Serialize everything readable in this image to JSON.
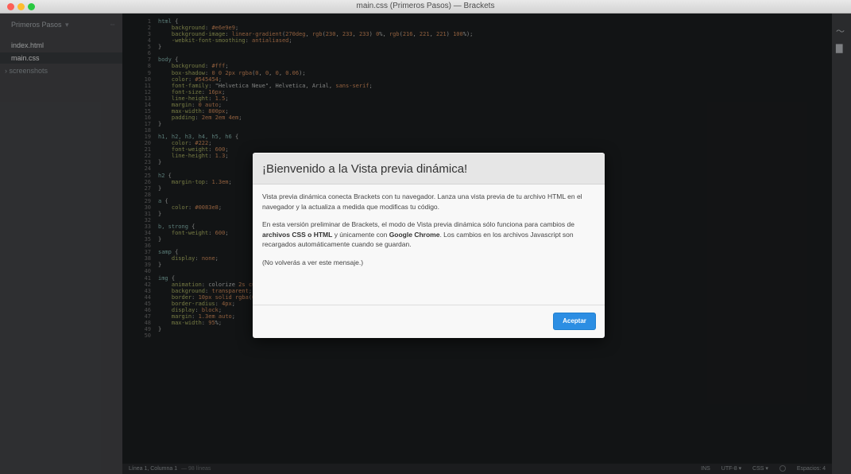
{
  "window": {
    "title": "main.css (Primeros Pasos) — Brackets"
  },
  "sidebar": {
    "project_name": "Primeros Pasos",
    "project_caret": "▾",
    "split_icon": "⇔",
    "files": [
      {
        "label": "index.html"
      },
      {
        "label": "main.css"
      },
      {
        "label": "› screenshots"
      }
    ]
  },
  "editor": {
    "lines": [
      "html {",
      "    background: #e6e9e9;",
      "    background-image: linear-gradient(270deg, rgb(230, 233, 233) 0%, rgb(216, 221, 221) 100%);",
      "    -webkit-font-smoothing: antialiased;",
      "}",
      "",
      "body {",
      "    background: #fff;",
      "    box-shadow: 0 0 2px rgba(0, 0, 0, 0.06);",
      "    color: #545454;",
      "    font-family: \"Helvetica Neue\", Helvetica, Arial, sans-serif;",
      "    font-size: 16px;",
      "    line-height: 1.5;",
      "    margin: 0 auto;",
      "    max-width: 800px;",
      "    padding: 2em 2em 4em;",
      "}",
      "",
      "h1, h2, h3, h4, h5, h6 {",
      "    color: #222;",
      "    font-weight: 600;",
      "    line-height: 1.3;",
      "}",
      "",
      "h2 {",
      "    margin-top: 1.3em;",
      "}",
      "",
      "a {",
      "    color: #0083e8;",
      "}",
      "",
      "b, strong {",
      "    font-weight: 600;",
      "}",
      "",
      "samp {",
      "    display: none;",
      "}",
      "",
      "img {",
      "    animation: colorize 2s cubic-bezier(0, 0, .78, .36) 1;",
      "    background: transparent;",
      "    border: 10px solid rgba(0, 0, 0, 0.12);",
      "    border-radius: 4px;",
      "    display: block;",
      "    margin: 1.3em auto;",
      "    max-width: 95%;",
      "}",
      ""
    ]
  },
  "statusbar": {
    "position": "Línea 1, Columna 1",
    "line_count": "— 98 líneas",
    "ins": "INS",
    "encoding": "UTF-8 ▾",
    "language": "CSS ▾",
    "spaces": "Espacios: 4"
  },
  "rightbar": {
    "icons": [
      "live-preview-icon",
      "extension-manager-icon"
    ],
    "live_glyph": "〜",
    "ext_glyph": "▇"
  },
  "modal": {
    "title": "¡Bienvenido a la Vista previa dinámica!",
    "para1": "Vista previa dinámica conecta Brackets con tu navegador. Lanza una vista previa de tu archivo HTML en el navegador y la actualiza a medida que modificas tu código.",
    "para2_a": "En esta versión preliminar de Brackets, el modo de Vista previa dinámica sólo funciona para cambios de ",
    "para2_b": "archivos CSS o HTML",
    "para2_c": " y únicamente con ",
    "para2_d": "Google Chrome",
    "para2_e": ". Los cambios en los archivos Javascript son recargados automáticamente cuando se guardan.",
    "para3": "(No volverás a ver este mensaje.)",
    "accept_label": "Aceptar"
  },
  "colors": {
    "accent": "#2c8ee3",
    "editor_bg": "#1d1f21",
    "sidebar_bg": "#47484b"
  }
}
